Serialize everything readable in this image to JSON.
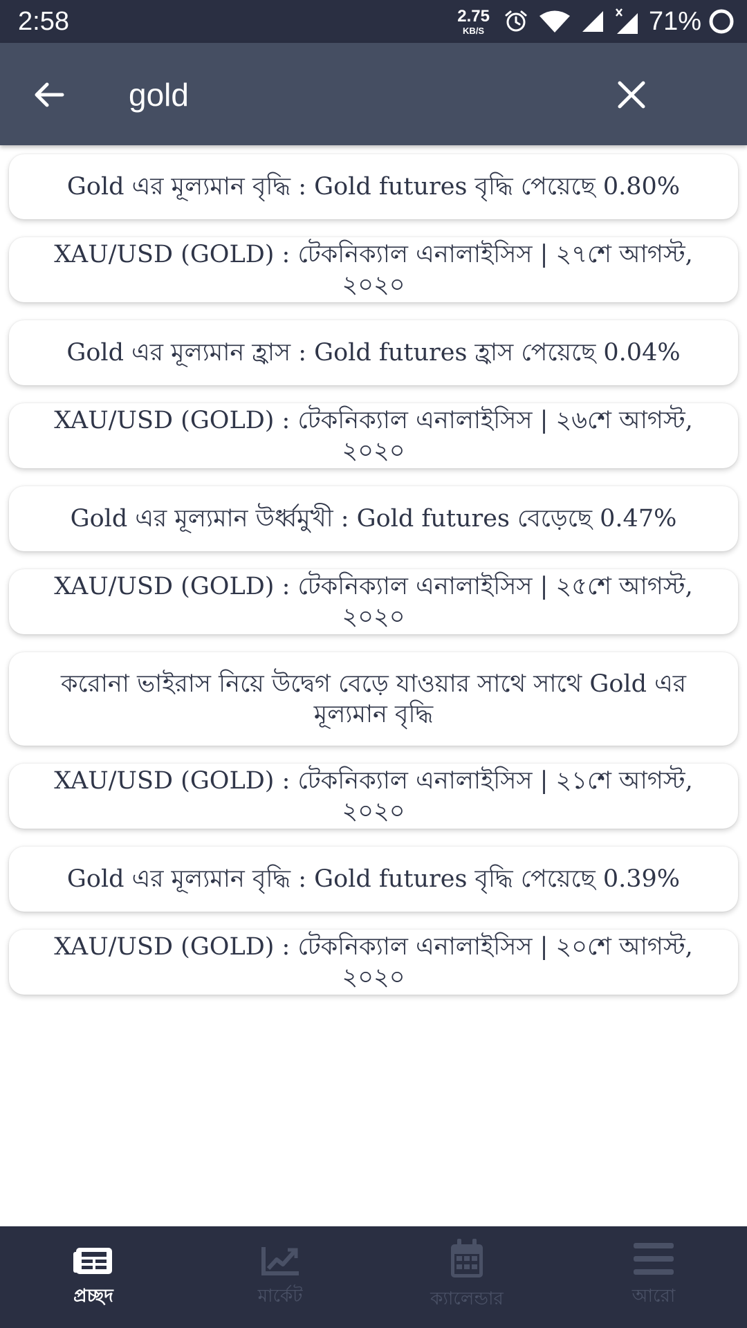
{
  "status_bar": {
    "time": "2:58",
    "speed_value": "2.75",
    "speed_unit": "KB/S",
    "battery": "71%",
    "icons": [
      "alarm-icon",
      "wifi-icon",
      "signal-icon",
      "signal-no-data-icon",
      "battery-icon"
    ]
  },
  "search": {
    "value": "gold",
    "back_icon": "arrow-left-icon",
    "clear_icon": "close-icon"
  },
  "results": [
    "Gold এর মূল্যমান বৃদ্ধি : Gold futures বৃদ্ধি পেয়েছে 0.80%",
    "XAU/USD (GOLD) : টেকনিক্যাল এনালাইসিস | ২৭শে আগস্ট, ২০২০",
    "Gold এর মূল্যমান হ্রাস : Gold futures হ্রাস পেয়েছে 0.04%",
    "XAU/USD (GOLD) : টেকনিক্যাল এনালাইসিস | ২৬শে আগস্ট, ২০২০",
    "Gold এর মূল্যমান উর্ধ্বমুখী : Gold futures বেড়েছে 0.47%",
    "XAU/USD (GOLD) : টেকনিক্যাল এনালাইসিস | ২৫শে আগস্ট, ২০২০",
    "করোনা ভাইরাস নিয়ে উদ্বেগ বেড়ে যাওয়ার সাথে সাথে Gold এর মূল্যমান বৃদ্ধি",
    "XAU/USD (GOLD) : টেকনিক্যাল এনালাইসিস | ২১শে আগস্ট, ২০২০",
    "Gold এর মূল্যমান বৃদ্ধি : Gold futures বৃদ্ধি পেয়েছে 0.39%",
    "XAU/USD (GOLD) : টেকনিক্যাল এনালাইসিস | ২০শে আগস্ট, ২০২০"
  ],
  "bottom_nav": [
    {
      "label": "প্রচ্ছদ",
      "icon": "newspaper-icon",
      "active": true
    },
    {
      "label": "মার্কেট",
      "icon": "chart-line-icon",
      "active": false
    },
    {
      "label": "ক্যালেন্ডার",
      "icon": "calendar-icon",
      "active": false
    },
    {
      "label": "আরো",
      "icon": "menu-icon",
      "active": false
    }
  ],
  "colors": {
    "status_bar": "#2a2f42",
    "search_bar": "#454e62",
    "bottom_nav": "#2a2f42",
    "card_text": "#2f3548",
    "nav_active": "#ffffff",
    "nav_inactive": "#4a5166"
  }
}
